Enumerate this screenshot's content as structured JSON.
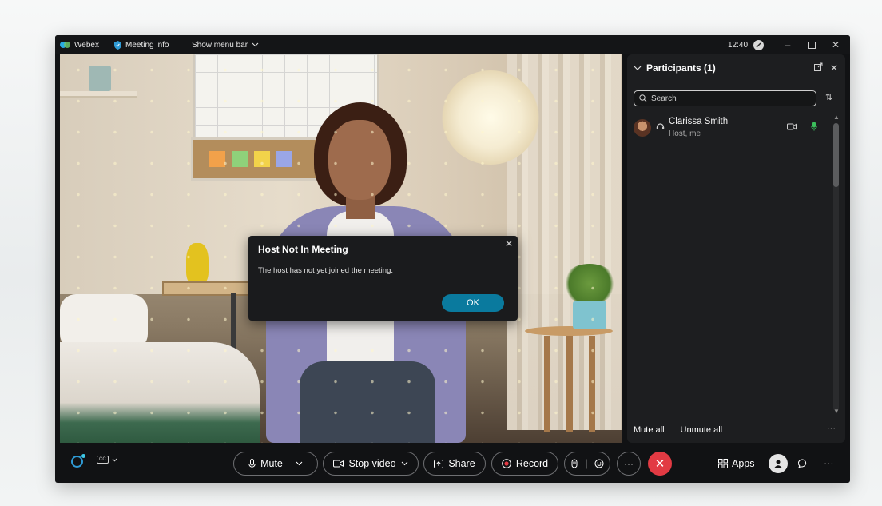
{
  "titlebar": {
    "app_name": "Webex",
    "meeting_info": "Meeting info",
    "show_menu_bar": "Show menu bar",
    "time": "12:40"
  },
  "dialog": {
    "title": "Host Not In Meeting",
    "message": "The host has not yet joined the meeting.",
    "ok_label": "OK"
  },
  "participants": {
    "title": "Participants (1)",
    "search_placeholder": "Search",
    "list": [
      {
        "name": "Clarissa Smith",
        "role": "Host, me",
        "mic_status": "unmuted",
        "video_status": "on"
      }
    ],
    "mute_all": "Mute all",
    "unmute_all": "Unmute all"
  },
  "toolbar": {
    "mute_label": "Mute",
    "stop_video_label": "Stop video",
    "share_label": "Share",
    "record_label": "Record",
    "apps_label": "Apps"
  },
  "colors": {
    "accent": "#0a7a9e",
    "end_call": "#e23a43",
    "mic_active": "#3bbf5b",
    "ai_assistant": "#2f9bd6"
  },
  "icons": {
    "window": [
      "webex-logo-icon",
      "shield-icon",
      "chevron-down-icon",
      "status-icon",
      "minimize-icon",
      "maximize-icon",
      "close-icon"
    ],
    "panel": [
      "chevron-down-icon",
      "popout-icon",
      "close-icon",
      "search-icon",
      "sort-icon",
      "headset-icon",
      "camera-icon",
      "microphone-icon"
    ],
    "toolbar": [
      "ai-assistant-icon",
      "closed-captions-icon",
      "microphone-icon",
      "camera-icon",
      "share-icon",
      "record-icon",
      "raise-hand-icon",
      "reactions-icon",
      "more-icon",
      "end-call-icon",
      "apps-icon",
      "participants-icon",
      "chat-icon"
    ]
  }
}
